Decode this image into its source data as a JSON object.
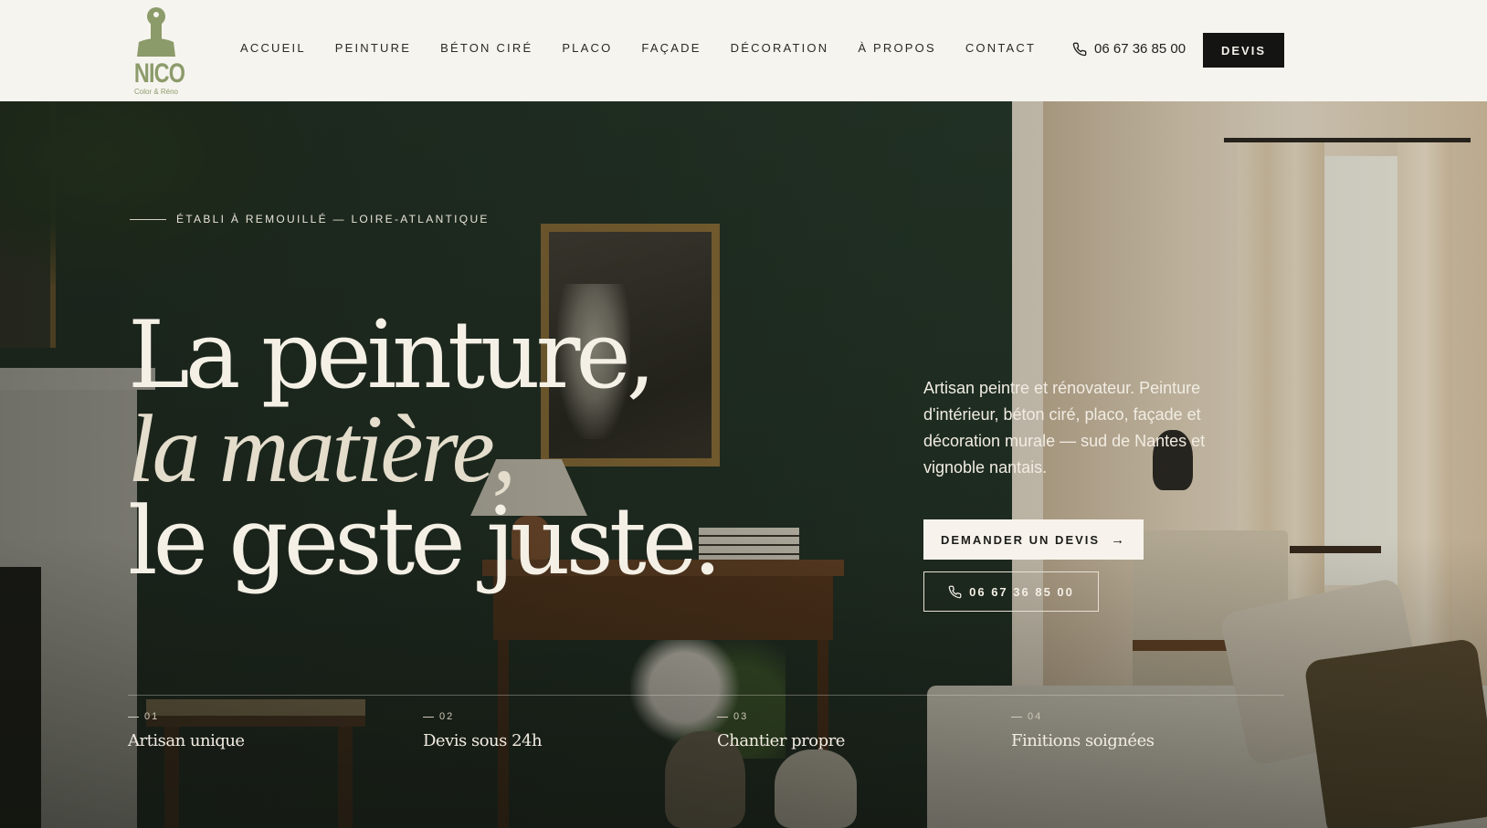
{
  "brand": {
    "name": "NICO",
    "tagline": "Color & Réno",
    "color": "#8c9b6a"
  },
  "nav": {
    "items": [
      {
        "label": "ACCUEIL"
      },
      {
        "label": "PEINTURE"
      },
      {
        "label": "BÉTON CIRÉ"
      },
      {
        "label": "PLACO"
      },
      {
        "label": "FAÇADE"
      },
      {
        "label": "DÉCORATION"
      },
      {
        "label": "À PROPOS"
      },
      {
        "label": "CONTACT"
      }
    ],
    "phone": "06 67 36 85 00",
    "phone_icon": "phone-icon",
    "cta": "DEVIS"
  },
  "hero": {
    "eyebrow": "ÉTABLI À REMOUILLÉ — LOIRE-ATLANTIQUE",
    "headline": {
      "line1": "La peinture,",
      "line2": "la matière,",
      "line3": "le geste juste."
    },
    "intro": "Artisan peintre et rénovateur. Peinture d'intérieur, béton ciré, placo, façade et décoration murale — sud de Nantes et vignoble nantais.",
    "cta_primary": "DEMANDER UN DEVIS",
    "cta_primary_icon": "arrow-right-icon",
    "cta_secondary": "06 67 36 85 00",
    "cta_secondary_icon": "phone-icon"
  },
  "features": [
    {
      "num": "01",
      "title": "Artisan unique"
    },
    {
      "num": "02",
      "title": "Devis sous 24h"
    },
    {
      "num": "03",
      "title": "Chantier propre"
    },
    {
      "num": "04",
      "title": "Finitions soignées"
    }
  ],
  "colors": {
    "header_bg": "#f6f4ef",
    "dark_button": "#141412",
    "wall_green": "#26382a",
    "text_light": "#f5f0e6"
  }
}
